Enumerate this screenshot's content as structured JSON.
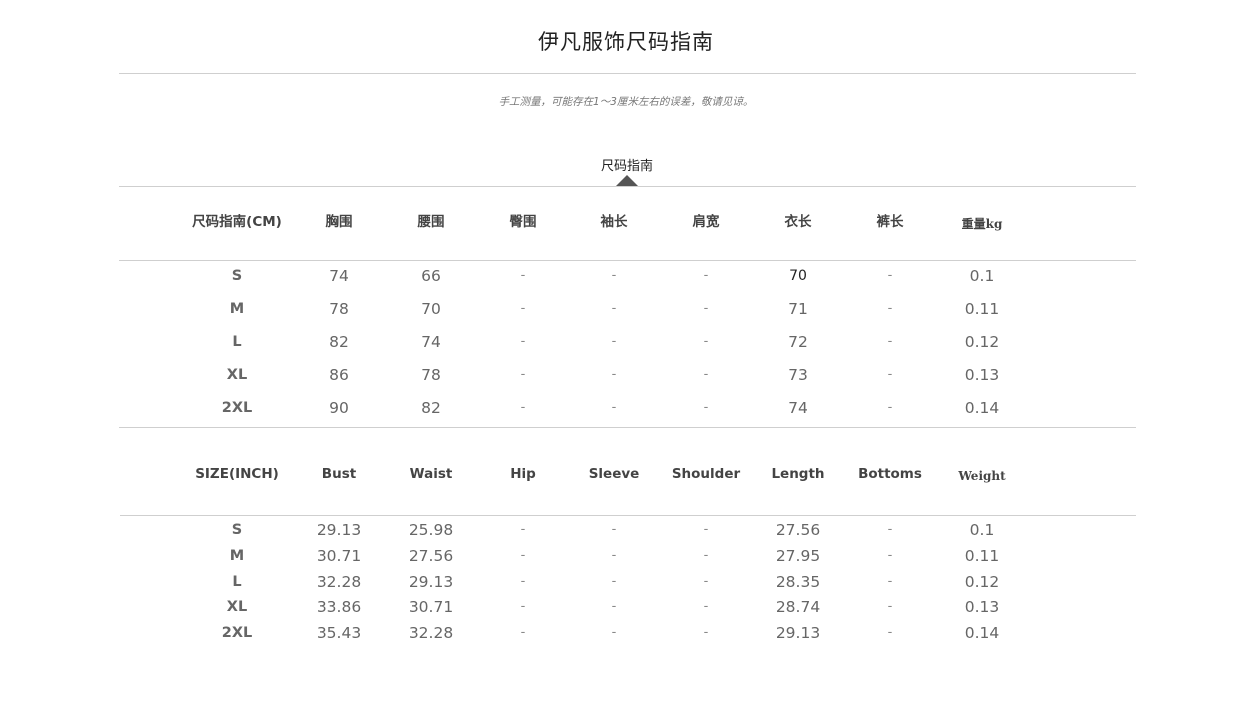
{
  "title": "伊凡服饰尺码指南",
  "note": "手工测量，可能存在1～3厘米左右的误差，敬请见谅。",
  "tab_label": "尺码指南",
  "cm_table": {
    "headers": [
      "尺码指南(CM)",
      "胸围",
      "腰围",
      "臀围",
      "袖长",
      "肩宽",
      "衣长",
      "裤长",
      "重量kg"
    ],
    "rows": [
      [
        "S",
        "74",
        "66",
        "-",
        "-",
        "-",
        "70",
        "-",
        "0.1"
      ],
      [
        "M",
        "78",
        "70",
        "-",
        "-",
        "-",
        "71",
        "-",
        "0.11"
      ],
      [
        "L",
        "82",
        "74",
        "-",
        "-",
        "-",
        "72",
        "-",
        "0.12"
      ],
      [
        "XL",
        "86",
        "78",
        "-",
        "-",
        "-",
        "73",
        "-",
        "0.13"
      ],
      [
        "2XL",
        "90",
        "82",
        "-",
        "-",
        "-",
        "74",
        "-",
        "0.14"
      ]
    ]
  },
  "inch_table": {
    "headers": [
      "SIZE(INCH)",
      "Bust",
      "Waist",
      "Hip",
      "Sleeve",
      "Shoulder",
      "Length",
      "Bottoms",
      "Weight"
    ],
    "rows": [
      [
        "S",
        "29.13",
        "25.98",
        "-",
        "-",
        "-",
        "27.56",
        "-",
        "0.1"
      ],
      [
        "M",
        "30.71",
        "27.56",
        "-",
        "-",
        "-",
        "27.95",
        "-",
        "0.11"
      ],
      [
        "L",
        "32.28",
        "29.13",
        "-",
        "-",
        "-",
        "28.35",
        "-",
        "0.12"
      ],
      [
        "XL",
        "33.86",
        "30.71",
        "-",
        "-",
        "-",
        "28.74",
        "-",
        "0.13"
      ],
      [
        "2XL",
        "35.43",
        "32.28",
        "-",
        "-",
        "-",
        "29.13",
        "-",
        "0.14"
      ]
    ]
  }
}
